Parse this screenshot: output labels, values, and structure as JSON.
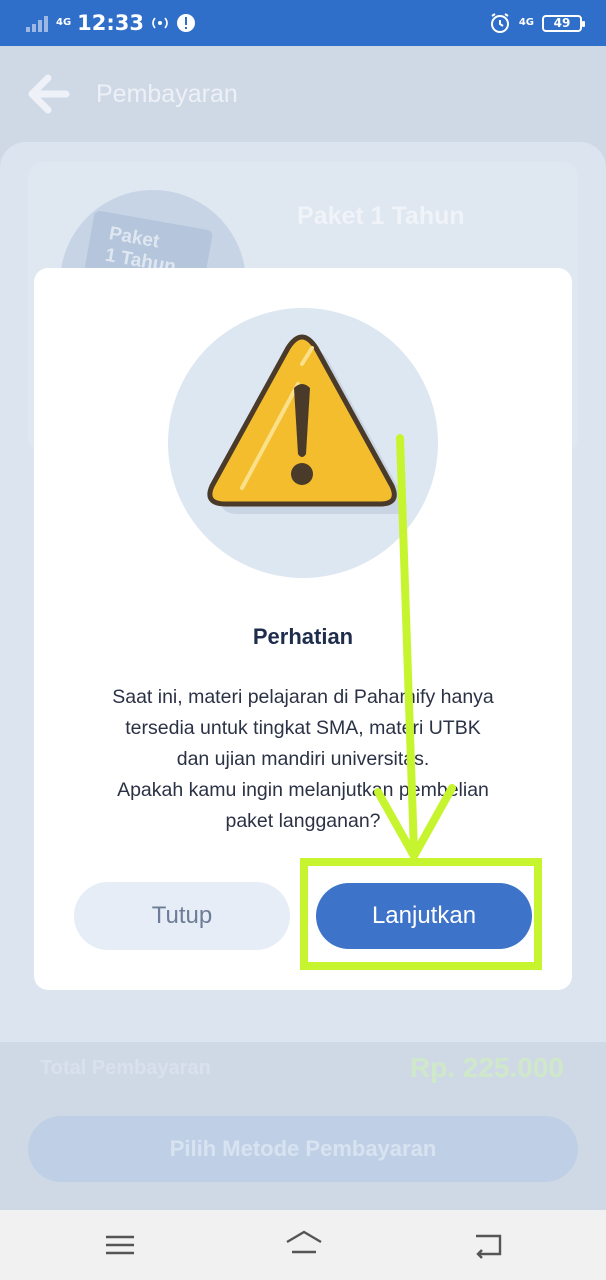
{
  "status_bar": {
    "network_left": "4G",
    "time": "12:33",
    "network_right": "4G",
    "battery": "49"
  },
  "app_bar": {
    "title": "Pembayaran",
    "back_icon": "arrow-left-icon"
  },
  "package": {
    "image_text": "Paket\n1 Tahun",
    "name": "Paket 1 Tahun"
  },
  "summary": {
    "total_label": "Total Pembayaran",
    "total_value": "Rp. 225.000",
    "total_color": "#cfe8c9"
  },
  "pay_button": {
    "label": "Pilih Metode Pembayaran"
  },
  "dialog": {
    "icon": "warning-triangle-icon",
    "title": "Perhatian",
    "message_lines": [
      "Saat ini, materi pelajaran di Pahamify hanya",
      "tersedia untuk tingkat SMA, materi UTBK",
      "dan ujian mandiri universitas.",
      "Apakah kamu ingin melanjutkan pembelian",
      "paket langganan?"
    ],
    "cancel_label": "Tutup",
    "confirm_label": "Lanjutkan",
    "accent_color": "#3d73c9"
  },
  "annotation": {
    "color": "#c6f52f",
    "type": "arrow-and-highlight-box"
  },
  "nav_bar": {
    "icons": [
      "menu-icon",
      "home-icon",
      "back-icon"
    ]
  }
}
